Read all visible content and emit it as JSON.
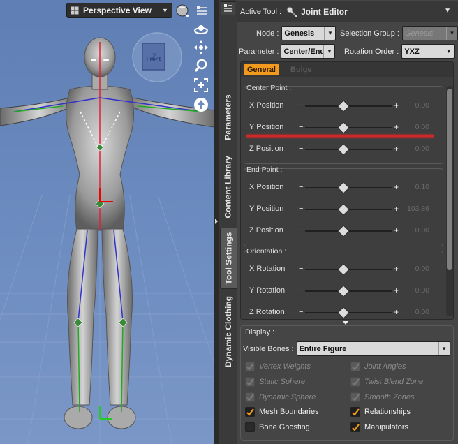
{
  "viewport": {
    "title": "Perspective View",
    "cube_face": "Front",
    "cube_letter": "Z"
  },
  "side_tabs": [
    "Parameters",
    "Content Library",
    "Tool Settings",
    "Dynamic Clothing"
  ],
  "active_side_tab": "Tool Settings",
  "tool": {
    "label": "Active Tool :",
    "name": "Joint Editor"
  },
  "fields": {
    "node_label": "Node :",
    "node_value": "Genesis",
    "selection_group_label": "Selection Group :",
    "selection_group_value": "Genesis",
    "parameter_label": "Parameter :",
    "parameter_value": "Center/End",
    "rotation_order_label": "Rotation Order :",
    "rotation_order_value": "YXZ"
  },
  "tabs": {
    "general": "General",
    "bulge": "Bulge"
  },
  "sections": {
    "center_point": {
      "title": "Center Point :",
      "rows": [
        {
          "name": "X Position",
          "value": "0.00"
        },
        {
          "name": "Y Position",
          "value": "0.00"
        },
        {
          "name": "Z Position",
          "value": "0.00"
        }
      ]
    },
    "end_point": {
      "title": "End Point :",
      "rows": [
        {
          "name": "X Position",
          "value": "0.10"
        },
        {
          "name": "Y Position",
          "value": "103.86"
        },
        {
          "name": "Z Position",
          "value": "0.00"
        }
      ]
    },
    "orientation": {
      "title": "Orientation :",
      "rows": [
        {
          "name": "X Rotation",
          "value": "0.00"
        },
        {
          "name": "Y Rotation",
          "value": "0.00"
        },
        {
          "name": "Z Rotation",
          "value": "0.00"
        }
      ]
    }
  },
  "display": {
    "title": "Display :",
    "visible_bones_label": "Visible Bones :",
    "visible_bones_value": "Entire Figure",
    "checks_left": [
      {
        "label": "Vertex Weights",
        "state": "disabled"
      },
      {
        "label": "Static Sphere",
        "state": "disabled"
      },
      {
        "label": "Dynamic Sphere",
        "state": "disabled"
      },
      {
        "label": "Mesh Boundaries",
        "state": "checked"
      },
      {
        "label": "Bone Ghosting",
        "state": "unchecked"
      }
    ],
    "checks_right": [
      {
        "label": "Joint Angles",
        "state": "disabled"
      },
      {
        "label": "Twist Blend Zone",
        "state": "disabled"
      },
      {
        "label": "Smooth Zones",
        "state": "disabled"
      },
      {
        "label": "Relationships",
        "state": "checked"
      },
      {
        "label": "Manipulators",
        "state": "checked"
      }
    ]
  },
  "colors": {
    "accent": "#f29a1e",
    "viewport_bg": "#6d8cc0",
    "highlight": "#e62828"
  }
}
